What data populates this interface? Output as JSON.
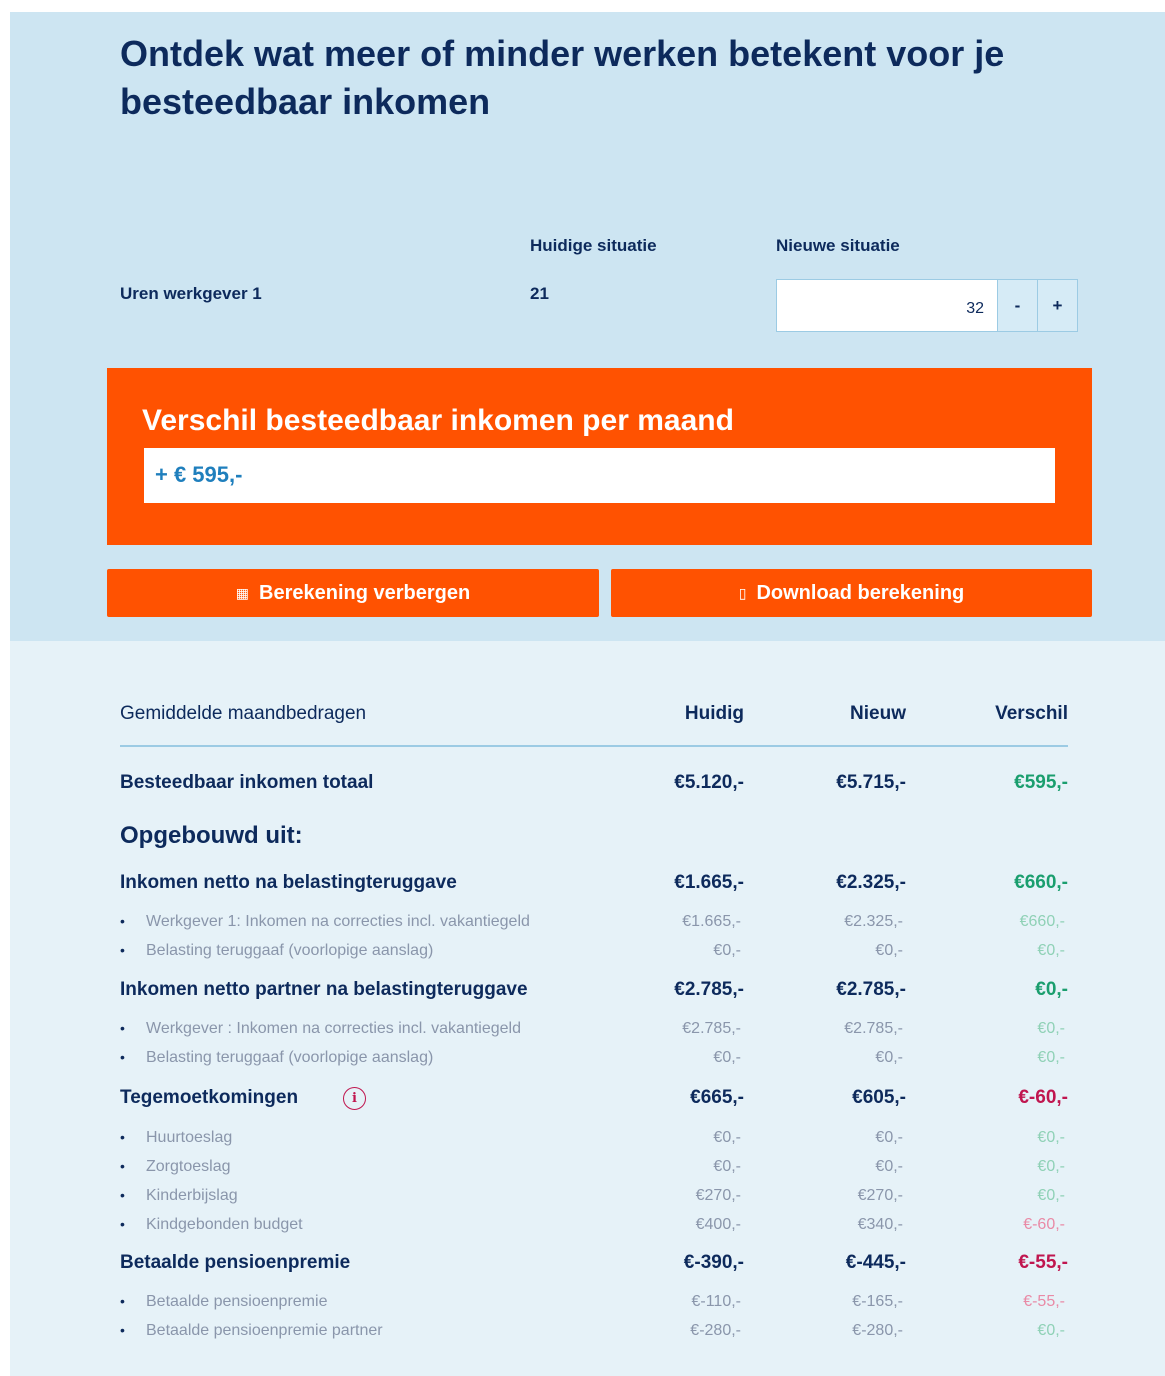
{
  "page": {
    "title": "Ontdek wat meer of minder werken betekent voor je besteedbaar inkomen"
  },
  "situation": {
    "current_header": "Huidige situatie",
    "new_header": "Nieuwe situatie",
    "row_label": "Uren werkgever 1",
    "current_value": "21",
    "new_value": "32",
    "minus_label": "-",
    "plus_label": "+"
  },
  "difference": {
    "title": "Verschil besteedbaar inkomen per maand",
    "value": "+ € 595,-"
  },
  "actions": {
    "hide_label": "Berekening verbergen",
    "hide_icon": "calculator-icon",
    "download_label": "Download berekening",
    "download_icon": "document-icon"
  },
  "table": {
    "headers": {
      "label": "Gemiddelde maandbedragen",
      "current": "Huidig",
      "new": "Nieuw",
      "diff": "Verschil"
    },
    "total": {
      "label": "Besteedbaar inkomen totaal",
      "current": "€5.120,-",
      "new": "€5.715,-",
      "diff": "€595,-"
    },
    "composed_label": "Opgebouwd uit:",
    "sections": [
      {
        "label": "Inkomen netto na belastingteruggave",
        "current": "€1.665,-",
        "new": "€2.325,-",
        "diff": "€660,-",
        "items": [
          {
            "label": "Werkgever 1: Inkomen na correcties incl. vakantiegeld",
            "current": "€1.665,-",
            "new": "€2.325,-",
            "diff": "€660,-"
          },
          {
            "label": "Belasting teruggaaf (voorlopige aanslag)",
            "current": "€0,-",
            "new": "€0,-",
            "diff": "€0,-"
          }
        ]
      },
      {
        "label": "Inkomen netto partner na belastingteruggave",
        "current": "€2.785,-",
        "new": "€2.785,-",
        "diff": "€0,-",
        "items": [
          {
            "label": "Werkgever : Inkomen na correcties incl. vakantiegeld",
            "current": "€2.785,-",
            "new": "€2.785,-",
            "diff": "€0,-"
          },
          {
            "label": "Belasting teruggaaf (voorlopige aanslag)",
            "current": "€0,-",
            "new": "€0,-",
            "diff": "€0,-"
          }
        ]
      },
      {
        "label": "Tegemoetkomingen",
        "info_icon": "i",
        "current": "€665,-",
        "new": "€605,-",
        "diff": "€-60,-",
        "items": [
          {
            "label": "Huurtoeslag",
            "current": "€0,-",
            "new": "€0,-",
            "diff": "€0,-"
          },
          {
            "label": "Zorgtoeslag",
            "current": "€0,-",
            "new": "€0,-",
            "diff": "€0,-"
          },
          {
            "label": "Kinderbijslag",
            "current": "€270,-",
            "new": "€270,-",
            "diff": "€0,-"
          },
          {
            "label": "Kindgebonden budget",
            "current": "€400,-",
            "new": "€340,-",
            "diff": "€-60,-"
          }
        ]
      },
      {
        "label": "Betaalde pensioenpremie",
        "current": "€-390,-",
        "new": "€-445,-",
        "diff": "€-55,-",
        "items": [
          {
            "label": "Betaalde pensioenpremie",
            "current": "€-110,-",
            "new": "€-165,-",
            "diff": "€-55,-"
          },
          {
            "label": "Betaalde pensioenpremie partner",
            "current": "€-280,-",
            "new": "€-280,-",
            "diff": "€0,-"
          }
        ]
      }
    ]
  },
  "colors": {
    "brand_orange": "#ff5201",
    "navy_text": "#0d2a5c",
    "positive": "#1a9e6e",
    "negative": "#c0164f"
  }
}
